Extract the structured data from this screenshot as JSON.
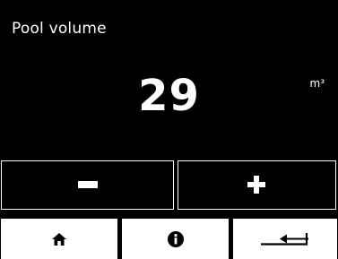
{
  "screen": {
    "title": "Pool volume",
    "value": "29",
    "unit": "m³"
  },
  "stepper": {
    "decrease_icon": "minus-icon",
    "increase_icon": "plus-icon"
  },
  "nav": {
    "items": [
      {
        "icon": "home-icon"
      },
      {
        "icon": "info-icon"
      },
      {
        "icon": "back-arrow-icon"
      }
    ]
  },
  "colors": {
    "background": "#000000",
    "foreground": "#ffffff"
  }
}
